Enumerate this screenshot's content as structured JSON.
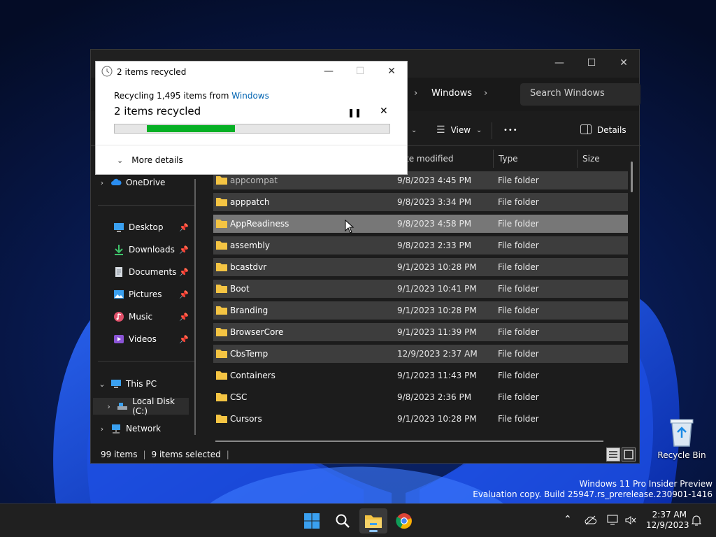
{
  "desktop": {
    "recycle_bin_label": "Recycle Bin",
    "watermark_line1": "Windows 11 Pro Insider Preview",
    "watermark_line2": "Evaluation copy. Build 25947.rs_prerelease.230901-1416"
  },
  "explorer": {
    "breadcrumb": "Windows",
    "search_placeholder": "Search Windows",
    "toolbar": {
      "view_label": "View",
      "more_label": "•••",
      "details_label": "Details"
    },
    "columns": {
      "date_modified": "te modified",
      "type": "Type",
      "size": "Size"
    },
    "nav": {
      "onedrive": "OneDrive",
      "desktop": "Desktop",
      "downloads": "Downloads",
      "documents": "Documents",
      "pictures": "Pictures",
      "music": "Music",
      "videos": "Videos",
      "this_pc": "This PC",
      "local_disk": "Local Disk (C:)",
      "network": "Network"
    },
    "rows": [
      {
        "name": "appcompat",
        "date": "9/8/2023 4:45 PM",
        "type": "File folder"
      },
      {
        "name": "apppatch",
        "date": "9/8/2023 3:34 PM",
        "type": "File folder"
      },
      {
        "name": "AppReadiness",
        "date": "9/8/2023 4:58 PM",
        "type": "File folder"
      },
      {
        "name": "assembly",
        "date": "9/8/2023 2:33 PM",
        "type": "File folder"
      },
      {
        "name": "bcastdvr",
        "date": "9/1/2023 10:28 PM",
        "type": "File folder"
      },
      {
        "name": "Boot",
        "date": "9/1/2023 10:41 PM",
        "type": "File folder"
      },
      {
        "name": "Branding",
        "date": "9/1/2023 10:28 PM",
        "type": "File folder"
      },
      {
        "name": "BrowserCore",
        "date": "9/1/2023 11:39 PM",
        "type": "File folder"
      },
      {
        "name": "CbsTemp",
        "date": "12/9/2023 2:37 AM",
        "type": "File folder"
      },
      {
        "name": "Containers",
        "date": "9/1/2023 11:43 PM",
        "type": "File folder"
      },
      {
        "name": "CSC",
        "date": "9/8/2023 2:36 PM",
        "type": "File folder"
      },
      {
        "name": "Cursors",
        "date": "9/1/2023 10:28 PM",
        "type": "File folder"
      }
    ],
    "status": {
      "item_count": "99 items",
      "sep": "|",
      "selected": "9 items selected",
      "sep2": "|"
    }
  },
  "dialog": {
    "title": "2 items recycled",
    "line1_prefix": "Recycling 1,495 items from ",
    "line1_link": "Windows",
    "line2": "2 items recycled",
    "progress": 0.32,
    "more_details": "More details"
  },
  "taskbar": {
    "time": "2:37 AM",
    "date": "12/9/2023"
  }
}
